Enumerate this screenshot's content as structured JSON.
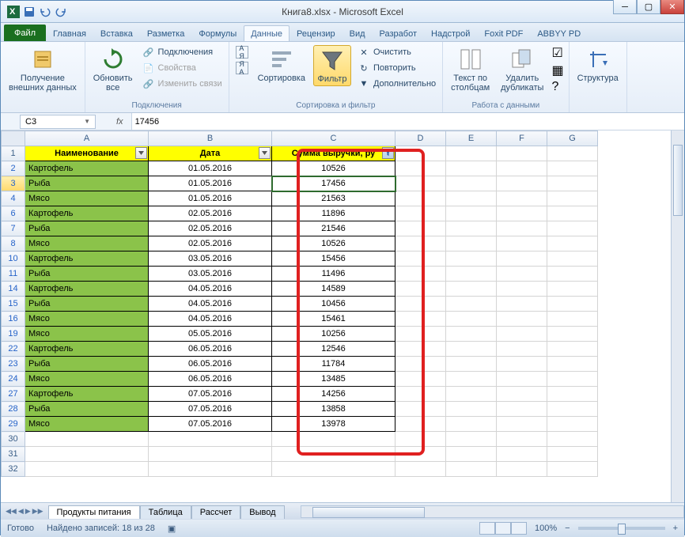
{
  "title": "Книга8.xlsx - Microsoft Excel",
  "tabs": {
    "file": "Файл",
    "list": [
      "Главная",
      "Вставка",
      "Разметка",
      "Формулы",
      "Данные",
      "Рецензир",
      "Вид",
      "Разработ",
      "Надстрой",
      "Foxit PDF",
      "ABBYY PD"
    ],
    "active": "Данные"
  },
  "ribbon": {
    "g1": {
      "btn": "Получение\nвнешних данных",
      "label": ""
    },
    "g2": {
      "btn": "Обновить\nвсе",
      "i1": "Подключения",
      "i2": "Свойства",
      "i3": "Изменить связи",
      "label": "Подключения"
    },
    "g3": {
      "az": "А↓Я",
      "za": "Я↓А",
      "sort": "Сортировка",
      "filter": "Фильтр",
      "c1": "Очистить",
      "c2": "Повторить",
      "c3": "Дополнительно",
      "label": "Сортировка и фильтр"
    },
    "g4": {
      "b1": "Текст по\nстолбцам",
      "b2": "Удалить\nдубликаты",
      "label": "Работа с данными"
    },
    "g5": {
      "btn": "Структура"
    }
  },
  "namebox": "C3",
  "formula": "17456",
  "columns": [
    "A",
    "B",
    "C",
    "D",
    "E",
    "F",
    "G"
  ],
  "headers": {
    "A": "Наименование",
    "B": "Дата",
    "C": "Сумма выручки, ру"
  },
  "rows": [
    {
      "n": 2,
      "a": "Картофель",
      "b": "01.05.2016",
      "c": "10526"
    },
    {
      "n": 3,
      "a": "Рыба",
      "b": "01.05.2016",
      "c": "17456"
    },
    {
      "n": 4,
      "a": "Мясо",
      "b": "01.05.2016",
      "c": "21563"
    },
    {
      "n": 6,
      "a": "Картофель",
      "b": "02.05.2016",
      "c": "11896"
    },
    {
      "n": 7,
      "a": "Рыба",
      "b": "02.05.2016",
      "c": "21546"
    },
    {
      "n": 8,
      "a": "Мясо",
      "b": "02.05.2016",
      "c": "10526"
    },
    {
      "n": 10,
      "a": "Картофель",
      "b": "03.05.2016",
      "c": "15456"
    },
    {
      "n": 11,
      "a": "Рыба",
      "b": "03.05.2016",
      "c": "11496"
    },
    {
      "n": 14,
      "a": "Картофель",
      "b": "04.05.2016",
      "c": "14589"
    },
    {
      "n": 15,
      "a": "Рыба",
      "b": "04.05.2016",
      "c": "10456"
    },
    {
      "n": 16,
      "a": "Мясо",
      "b": "04.05.2016",
      "c": "15461"
    },
    {
      "n": 19,
      "a": "Мясо",
      "b": "05.05.2016",
      "c": "10256"
    },
    {
      "n": 22,
      "a": "Картофель",
      "b": "06.05.2016",
      "c": "12546"
    },
    {
      "n": 23,
      "a": "Рыба",
      "b": "06.05.2016",
      "c": "11784"
    },
    {
      "n": 24,
      "a": "Мясо",
      "b": "06.05.2016",
      "c": "13485"
    },
    {
      "n": 27,
      "a": "Картофель",
      "b": "07.05.2016",
      "c": "14256"
    },
    {
      "n": 28,
      "a": "Рыба",
      "b": "07.05.2016",
      "c": "13858"
    },
    {
      "n": 29,
      "a": "Мясо",
      "b": "07.05.2016",
      "c": "13978"
    }
  ],
  "sheettabs": [
    "Продукты питания",
    "Таблица",
    "Рассчет",
    "Вывод"
  ],
  "status": {
    "ready": "Готово",
    "found": "Найдено записей: 18 из 28",
    "zoom": "100%"
  }
}
